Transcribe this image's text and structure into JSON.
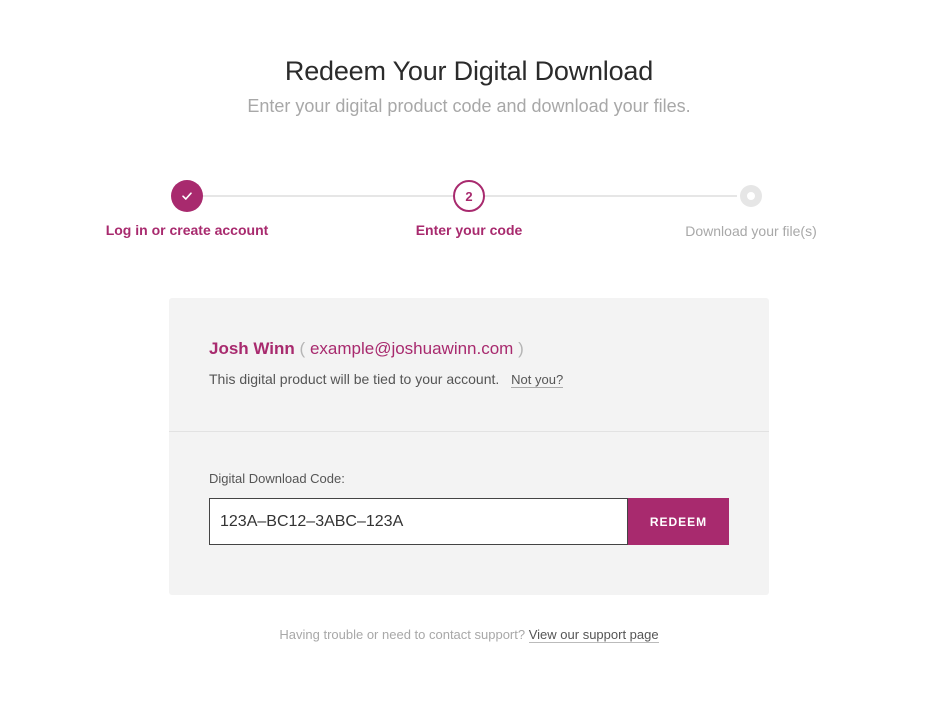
{
  "header": {
    "title": "Redeem Your Digital Download",
    "subtitle": "Enter your digital product code and download your files."
  },
  "steps": [
    {
      "label": "Log in or create account",
      "state": "complete",
      "icon": "check-icon"
    },
    {
      "label": "Enter your code",
      "state": "current",
      "number": "2"
    },
    {
      "label": "Download your file(s)",
      "state": "pending"
    }
  ],
  "account": {
    "name": "Josh Winn",
    "open_paren": "(",
    "email": "example@joshuawinn.com",
    "close_paren": ")",
    "tied_text": "This digital product will be tied to your account.",
    "not_you": "Not you?"
  },
  "code": {
    "label": "Digital Download Code:",
    "value": "123A–BC12–3ABC–123A",
    "button": "REDEEM"
  },
  "support": {
    "text": "Having trouble or need to contact support?",
    "link": "View our support page"
  },
  "colors": {
    "accent": "#a82a6e",
    "muted": "#a8a8a8",
    "card_bg": "#f3f3f3"
  }
}
